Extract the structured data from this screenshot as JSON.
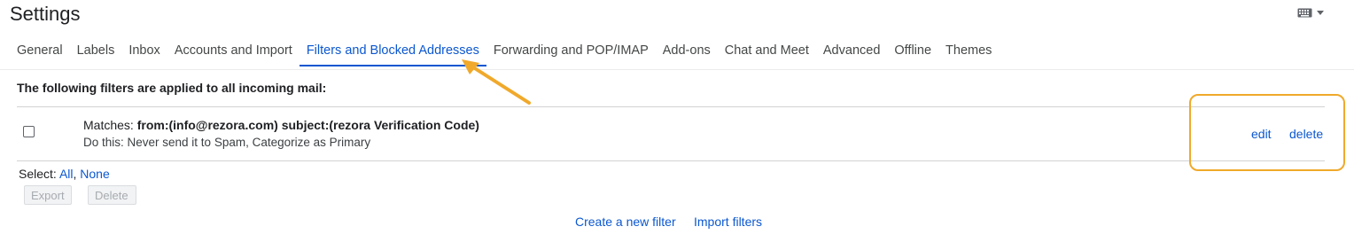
{
  "page_title": "Settings",
  "tabs": [
    {
      "label": "General",
      "active": false
    },
    {
      "label": "Labels",
      "active": false
    },
    {
      "label": "Inbox",
      "active": false
    },
    {
      "label": "Accounts and Import",
      "active": false
    },
    {
      "label": "Filters and Blocked Addresses",
      "active": true
    },
    {
      "label": "Forwarding and POP/IMAP",
      "active": false
    },
    {
      "label": "Add-ons",
      "active": false
    },
    {
      "label": "Chat and Meet",
      "active": false
    },
    {
      "label": "Advanced",
      "active": false
    },
    {
      "label": "Offline",
      "active": false
    },
    {
      "label": "Themes",
      "active": false
    }
  ],
  "filters_intro": "The following filters are applied to all incoming mail:",
  "filter": {
    "matches_label": "Matches:",
    "criteria": "from:(info@rezora.com) subject:(rezora Verification Code)",
    "action": "Do this: Never send it to Spam, Categorize as Primary",
    "edit_label": "edit",
    "delete_label": "delete",
    "checked": false
  },
  "select": {
    "prefix": "Select:",
    "all": "All",
    "separator": ",",
    "none": "None"
  },
  "buttons": {
    "export": "Export",
    "delete": "Delete"
  },
  "footer_links": {
    "create": "Create a new filter",
    "import": "Import filters"
  },
  "icons": {
    "input_tools": "keyboard-icon",
    "dropdown": "caret-down-icon"
  },
  "colors": {
    "accent": "#0b57d0",
    "annotation": "#f0a92b"
  }
}
